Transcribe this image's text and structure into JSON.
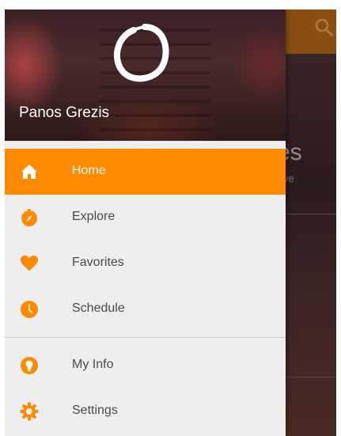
{
  "colors": {
    "accent": "#ff8a00",
    "drawer_bg": "#eeeeee",
    "text": "#4a4a4a",
    "active_text": "#ffffff"
  },
  "background_app": {
    "title_fragment": "es",
    "subtitle_fragment": "ve",
    "search_icon": "search-icon"
  },
  "drawer": {
    "user_name": "Panos Grezis",
    "logo": "enso-circle-logo",
    "primary_items": [
      {
        "label": "Home",
        "icon": "home-icon",
        "active": true
      },
      {
        "label": "Explore",
        "icon": "compass-icon",
        "active": false
      },
      {
        "label": "Favorites",
        "icon": "heart-icon",
        "active": false
      },
      {
        "label": "Schedule",
        "icon": "clock-icon",
        "active": false
      }
    ],
    "secondary_items": [
      {
        "label": "My Info",
        "icon": "user-icon",
        "active": false
      },
      {
        "label": "Settings",
        "icon": "gear-icon",
        "active": false
      }
    ]
  }
}
